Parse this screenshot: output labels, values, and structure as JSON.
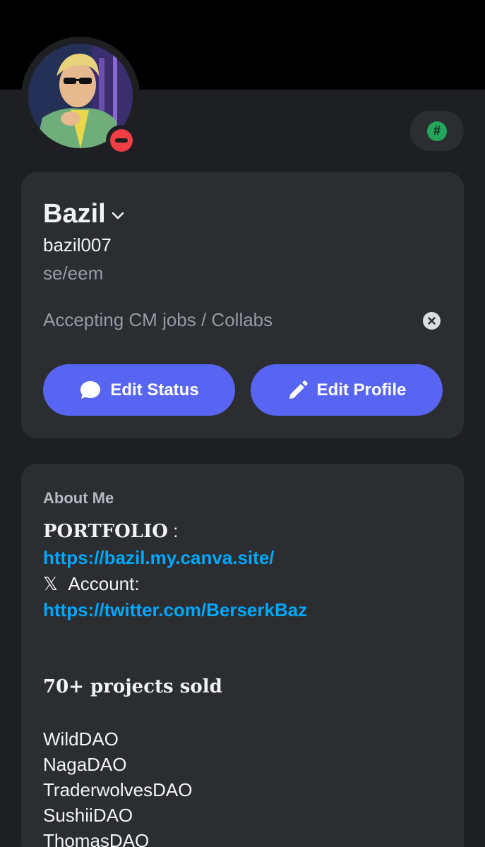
{
  "profile": {
    "display_name": "Bazil",
    "username": "bazil007",
    "pronouns": "se/eem",
    "custom_status": "Accepting CM jobs / Collabs",
    "status": "do-not-disturb",
    "nitro_badge_icon": "hashtag-icon"
  },
  "actions": {
    "edit_status_label": "Edit Status",
    "edit_profile_label": "Edit Profile"
  },
  "about": {
    "title": "About Me",
    "portfolio_label": "PORTFOLIO",
    "portfolio_colon": " :",
    "portfolio_url": "https://bazil.my.canva.site/",
    "x_symbol": "𝕏",
    "account_label": "Account:",
    "twitter_url": "https://twitter.com/BerserkBaz",
    "projects_sold": "70+ projects sold",
    "projects": [
      "WildDAO",
      "NagaDAO",
      "TraderwolvesDAO",
      "SushiiDAO",
      "ThomasDAO"
    ]
  },
  "colors": {
    "accent": "#5865f2",
    "link": "#00a8fc",
    "dnd": "#f23f43",
    "card": "#2b2d31",
    "background": "#1e1f22"
  }
}
